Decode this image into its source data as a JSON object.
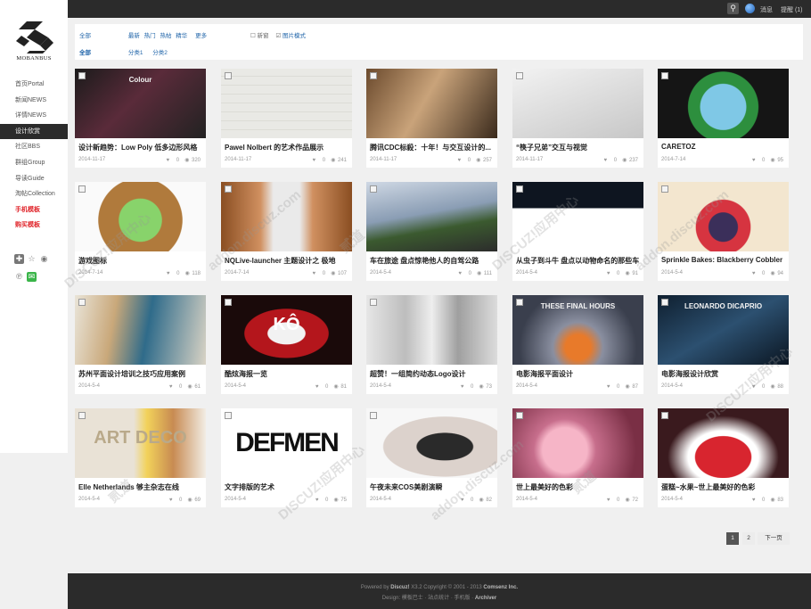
{
  "topbar": {
    "search_icon": "search-icon",
    "messages": "消息",
    "reminders": "提醒 (1)"
  },
  "sidebar": {
    "logo_text": "MOBANBUS",
    "items": [
      {
        "label": "首页Portal",
        "state": "normal"
      },
      {
        "label": "新闻NEWS",
        "state": "normal"
      },
      {
        "label": "详情NEWS",
        "state": "normal"
      },
      {
        "label": "设计欣赏",
        "state": "active"
      },
      {
        "label": "社区BBS",
        "state": "normal"
      },
      {
        "label": "群组Group",
        "state": "normal"
      },
      {
        "label": "导读Guide",
        "state": "normal"
      },
      {
        "label": "淘帖Collection",
        "state": "normal"
      },
      {
        "label": "手机模板",
        "state": "red"
      },
      {
        "label": "购买模板",
        "state": "red"
      }
    ]
  },
  "filter": {
    "row1": {
      "all": "全部",
      "options": [
        "最新",
        "热门",
        "热帖",
        "精华",
        "更多"
      ],
      "check1": "新窗",
      "check2": "图片模式"
    },
    "row2": {
      "all": "全部",
      "options": [
        "分类1",
        "分类2"
      ]
    }
  },
  "watermarks": [
    "DISCUZ!应用中心",
    "addon.discuz.com",
    "贰道"
  ],
  "cards": [
    {
      "title": "设计新趋势：Low Poly 低多边形风格",
      "date": "2014-11-17",
      "replies": "0",
      "views": "320",
      "bg": "linear-gradient(135deg,#1b1b1b,#5a2b3a 45%,#222)",
      "overlay": "Colour"
    },
    {
      "title": "Pawel Nolbert 的艺术作品展示",
      "date": "2014-11-17",
      "replies": "0",
      "views": "241",
      "bg": "repeating-linear-gradient(0deg,#e9e9e5 0 9px,#dcdcd6 9px 10px)"
    },
    {
      "title": "腾讯CDC标殺：十年！与交互设计的...",
      "date": "2014-11-17",
      "replies": "0",
      "views": "257",
      "bg": "linear-gradient(120deg,#6b4a2d,#c9a37a 45%,#3a2a1c)"
    },
    {
      "title": "“筷子兄弟”交互与视觉",
      "date": "2014-11-17",
      "replies": "0",
      "views": "237",
      "bg": "linear-gradient(160deg,#f2f2f2,#c7c7c7)"
    },
    {
      "title": "CARETOZ",
      "date": "2014-7-14",
      "replies": "0",
      "views": "95",
      "bg": "radial-gradient(circle at 50% 55%,#7fc8e6 0 30%,#2d8f3e 31% 46%,#151515 47%)"
    },
    {
      "title": "游戏图标",
      "date": "2014-7-14",
      "replies": "0",
      "views": "118",
      "bg": "radial-gradient(circle at 50% 55%,#88d36b 0 28%,#b07a3c 29% 55%,#fafafa 56%)"
    },
    {
      "title": "NQLive-launcher 主题设计之 极地",
      "date": "2014-7-14",
      "replies": "0",
      "views": "107",
      "bg": "linear-gradient(90deg,#8a4e22,#d09060 30%,#eaeaea 40% 60%,#d09060 70%,#8a4e22)"
    },
    {
      "title": "车在旅途 盘点惊艳他人的自驾公路",
      "date": "2014-5-4",
      "replies": "0",
      "views": "111",
      "bg": "linear-gradient(170deg,#cfd8e4,#8a9db4 45%,#3b5a2f 65%,#2c2c2c)"
    },
    {
      "title": "从虫子到斗牛 盘点以动物命名的那些车",
      "date": "2014-5-4",
      "replies": "0",
      "views": "91",
      "bg": "linear-gradient(180deg,#0e1520 0 38%,#ffffff 38%)"
    },
    {
      "title": "Sprinkle Bakes: Blackberry Cobbler",
      "date": "2014-5-4",
      "replies": "0",
      "views": "94",
      "bg": "radial-gradient(circle at 50% 65%,#3b2f5a 0 18%,#d63440 19% 34%,#f3e6cf 35%)"
    },
    {
      "title": "苏州平面设计培训之技巧应用案例",
      "date": "2014-5-4",
      "replies": "0",
      "views": "61",
      "bg": "linear-gradient(100deg,#e9e4d8,#c9a87a 30%,#2f6b8a 55%,#d9d3c5)"
    },
    {
      "title": "酷炫海报一览",
      "date": "2014-5-4",
      "replies": "0",
      "views": "81",
      "bg": "radial-gradient(ellipse at 50% 55%,#f2f2f2 0 20%,#b4161c 21% 45%,#1a0a0a 46%)",
      "overlay": "KÔ"
    },
    {
      "title": "超赞！一组简约动态Logo设计",
      "date": "2014-5-4",
      "replies": "0",
      "views": "73",
      "bg": "linear-gradient(90deg,#e6e6e6,#bdbdbd 30%,#eeeeee 50%,#9f9f9f 70%,#dcdcdc)"
    },
    {
      "title": "电影海报平面设计",
      "date": "2014-5-4",
      "replies": "0",
      "views": "87",
      "bg": "radial-gradient(circle at 50% 75%,#e87a2a 0 15%,#8a8fa0 30%,#3a3f4d 70%)",
      "overlay": "THESE FINAL HOURS"
    },
    {
      "title": "电影海报设计欣赏",
      "date": "2014-5-4",
      "replies": "0",
      "views": "88",
      "bg": "linear-gradient(150deg,#0f1f2f,#2c5070 50%,#0b1622)",
      "overlay": "LEONARDO DICAPRIO"
    },
    {
      "title": "Elle Netherlands 够主杂志在线",
      "date": "2014-5-4",
      "replies": "0",
      "views": "69",
      "bg": "linear-gradient(90deg,#e9e2d6 0 45%,#f2d25a 55%,#c88b52 75%,#f2ede5)",
      "overlay": "ART DECO"
    },
    {
      "title": "文字排版的艺术",
      "date": "2014-5-4",
      "replies": "0",
      "views": "75",
      "bg": "#ffffff",
      "overlay": "DEFMEN"
    },
    {
      "title": "午夜未来COS美剧演瞬",
      "date": "2014-5-4",
      "replies": "0",
      "views": "82",
      "bg": "radial-gradient(ellipse at 60% 55%,#2a2a2a 0 25%,#dcd2cc 26% 55%,#f7f7f7 56%)"
    },
    {
      "title": "世上最美好的色彩",
      "date": "2014-5-4",
      "replies": "0",
      "views": "72",
      "bg": "radial-gradient(circle at 40% 60%,#f6b5c7 0 25%,#c76e8c 35%,#7a2f45 80%)"
    },
    {
      "title": "蛋糕~水果~世上最美好的色彩",
      "date": "2014-5-4",
      "replies": "0",
      "views": "83",
      "bg": "radial-gradient(ellipse at 50% 70%,#d8252f 0 30%,#ffffff 31% 38%,#3a1a1e 60%)"
    }
  ],
  "pagination": {
    "page1": "1",
    "page2": "2",
    "next": "下一页"
  },
  "footer": {
    "powered_by": "Powered by",
    "discuz": "Discuz!",
    "version": "X3.2",
    "copyright": "Copyright © 2001 - 2013",
    "company": "Comsenz Inc.",
    "design_label": "Design:",
    "links": [
      "模板巴士",
      "站点统计",
      "手机版",
      "Archiver"
    ]
  }
}
